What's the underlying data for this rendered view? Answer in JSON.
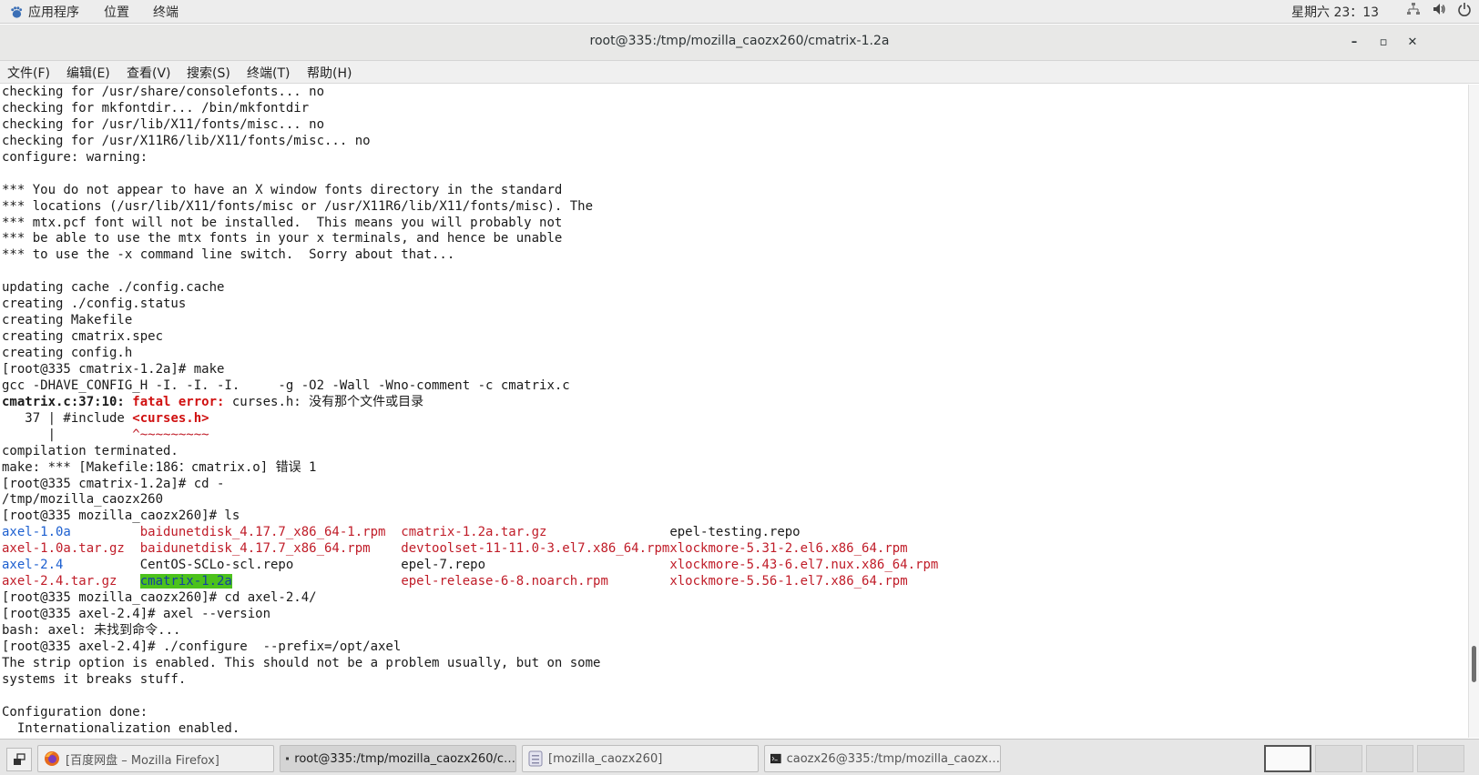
{
  "top_panel": {
    "app_menu": "应用程序",
    "places_menu": "位置",
    "terminal_menu": "终端",
    "clock": "星期六 23：13"
  },
  "window": {
    "title": "root@335:/tmp/mozilla_caozx260/cmatrix-1.2a",
    "minimize": "–",
    "maximize": "▫",
    "close": "✕"
  },
  "menubar": [
    "文件(F)",
    "编辑(E)",
    "查看(V)",
    "搜索(S)",
    "终端(T)",
    "帮助(H)"
  ],
  "terminal": {
    "lines": [
      [
        {
          "t": "checking for /usr/share/consolefonts... no"
        }
      ],
      [
        {
          "t": "checking for mkfontdir... /bin/mkfontdir"
        }
      ],
      [
        {
          "t": "checking for /usr/lib/X11/fonts/misc... no"
        }
      ],
      [
        {
          "t": "checking for /usr/X11R6/lib/X11/fonts/misc... no"
        }
      ],
      [
        {
          "t": "configure: warning:"
        }
      ],
      [
        {
          "t": ""
        }
      ],
      [
        {
          "t": "*** You do not appear to have an X window fonts directory in the standard"
        }
      ],
      [
        {
          "t": "*** locations (/usr/lib/X11/fonts/misc or /usr/X11R6/lib/X11/fonts/misc). The"
        }
      ],
      [
        {
          "t": "*** mtx.pcf font will not be installed.  This means you will probably not"
        }
      ],
      [
        {
          "t": "*** be able to use the mtx fonts in your x terminals, and hence be unable"
        }
      ],
      [
        {
          "t": "*** to use the -x command line switch.  Sorry about that..."
        }
      ],
      [
        {
          "t": ""
        }
      ],
      [
        {
          "t": "updating cache ./config.cache"
        }
      ],
      [
        {
          "t": "creating ./config.status"
        }
      ],
      [
        {
          "t": "creating Makefile"
        }
      ],
      [
        {
          "t": "creating cmatrix.spec"
        }
      ],
      [
        {
          "t": "creating config.h"
        }
      ],
      [
        {
          "t": "[root@335 cmatrix-1.2a]# make"
        }
      ],
      [
        {
          "t": "gcc -DHAVE_CONFIG_H -I. -I. -I.     -g -O2 -Wall -Wno-comment -c cmatrix.c"
        }
      ],
      [
        {
          "t": "cmatrix.c:37:10: ",
          "c": "bold"
        },
        {
          "t": "fatal error:",
          "c": "redb"
        },
        {
          "t": " curses.h: 没有那个文件或目录"
        }
      ],
      [
        {
          "t": "   37 | #include "
        },
        {
          "t": "<curses.h>",
          "c": "redb"
        }
      ],
      [
        {
          "t": "      |          "
        },
        {
          "t": "^~~~~~~~~~",
          "c": "red"
        }
      ],
      [
        {
          "t": "compilation terminated."
        }
      ],
      [
        {
          "t": "make: *** [Makefile:186：cmatrix.o] 错误 1"
        }
      ],
      [
        {
          "t": "[root@335 cmatrix-1.2a]# cd -"
        }
      ],
      [
        {
          "t": "/tmp/mozilla_caozx260"
        }
      ],
      [
        {
          "t": "[root@335 mozilla_caozx260]# ls"
        }
      ],
      [
        {
          "t": "axel-1.0a         ",
          "c": "blue"
        },
        {
          "t": "baidunetdisk_4.17.7_x86_64-1.rpm  ",
          "c": "red"
        },
        {
          "t": "cmatrix-1.2a.tar.gz                ",
          "c": "red"
        },
        {
          "t": "epel-testing.repo"
        }
      ],
      [
        {
          "t": "axel-1.0a.tar.gz  ",
          "c": "red"
        },
        {
          "t": "baidunetdisk_4.17.7_x86_64.rpm    ",
          "c": "red"
        },
        {
          "t": "devtoolset-11-11.0-3.el7.x86_64.rpm",
          "c": "red"
        },
        {
          "t": "xlockmore-5.31-2.el6.x86_64.rpm",
          "c": "red"
        }
      ],
      [
        {
          "t": "axel-2.4          ",
          "c": "blue"
        },
        {
          "t": "CentOS-SCLo-scl.repo              "
        },
        {
          "t": "epel-7.repo                        "
        },
        {
          "t": "xlockmore-5.43-6.el7.nux.x86_64.rpm",
          "c": "red"
        }
      ],
      [
        {
          "t": "axel-2.4.tar.gz   ",
          "c": "red"
        },
        {
          "t": "cmatrix-1.2a",
          "c": "hl"
        },
        {
          "t": "                      "
        },
        {
          "t": "epel-release-6-8.noarch.rpm        ",
          "c": "red"
        },
        {
          "t": "xlockmore-5.56-1.el7.x86_64.rpm",
          "c": "red"
        }
      ],
      [
        {
          "t": "[root@335 mozilla_caozx260]# cd axel-2.4/"
        }
      ],
      [
        {
          "t": "[root@335 axel-2.4]# axel --version"
        }
      ],
      [
        {
          "t": "bash: axel: 未找到命令..."
        }
      ],
      [
        {
          "t": "[root@335 axel-2.4]# ./configure  --prefix=/opt/axel"
        }
      ],
      [
        {
          "t": "The strip option is enabled. This should not be a problem usually, but on some"
        }
      ],
      [
        {
          "t": "systems it breaks stuff."
        }
      ],
      [
        {
          "t": ""
        }
      ],
      [
        {
          "t": "Configuration done:"
        }
      ],
      [
        {
          "t": "  Internationalization enabled."
        }
      ]
    ]
  },
  "taskbar": {
    "tasks": [
      {
        "label": "[百度网盘 – Mozilla Firefox]",
        "icon": "firefox-icon"
      },
      {
        "label": "root@335:/tmp/mozilla_caozx260/c…",
        "icon": "terminal-icon"
      },
      {
        "label": "[mozilla_caozx260]",
        "icon": "file-manager-icon"
      },
      {
        "label": "caozx26@335:/tmp/mozilla_caozx…",
        "icon": "terminal-icon"
      }
    ]
  },
  "colors": {
    "error_red": "#c01c28",
    "dir_blue": "#1c5fd0",
    "highlight_green": "#4cc21c"
  }
}
